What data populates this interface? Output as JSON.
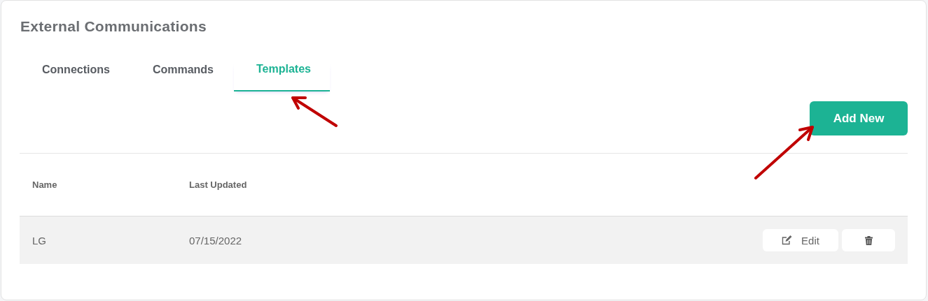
{
  "panel": {
    "title": "External Communications"
  },
  "tabs": [
    {
      "label": "Connections",
      "selected": false
    },
    {
      "label": "Commands",
      "selected": false
    },
    {
      "label": "Templates",
      "selected": true
    }
  ],
  "add_button": {
    "label": "Add New"
  },
  "table": {
    "columns": [
      "Name",
      "Last Updated"
    ],
    "rows": [
      {
        "name": "LG",
        "last_updated": "07/15/2022",
        "edit_label": "Edit"
      }
    ]
  }
}
